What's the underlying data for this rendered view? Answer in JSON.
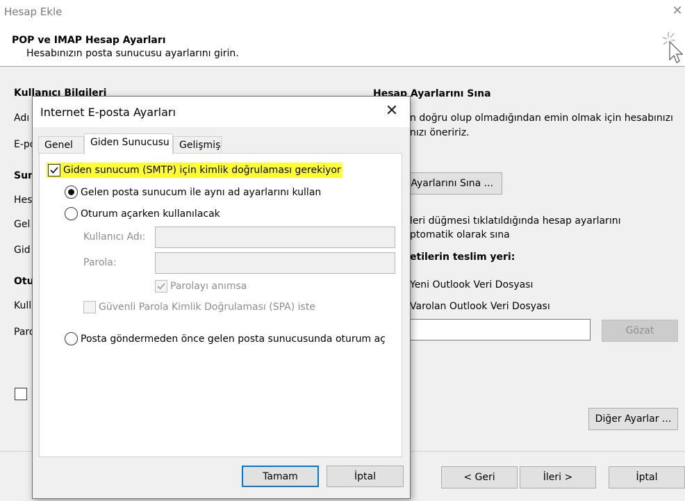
{
  "window": {
    "title": "Hesap Ekle",
    "heading": "POP ve IMAP Hesap Ayarları",
    "subheading": "Hesabınızın posta sunucusu ayarlarını girin."
  },
  "background": {
    "left_labels": [
      "Kullanıcı Bilgileri",
      "Adı",
      "E-po",
      "Sun",
      "Hes",
      "Gel",
      "Gid",
      "Otu",
      "Kull",
      "Paro"
    ],
    "test_section_title": "Hesap Ayarlarını Sına",
    "test_desc_line1": "n doğru olup olmadığından emin olmak için hesabınızı",
    "test_desc_line2": "nızı öneririz.",
    "test_button": "p Ayarlarını Sına ...",
    "auto_test_line1": "leri düğmesi tıklatıldığında hesap ayarlarını",
    "auto_test_line2": "ptomatik olarak sına",
    "delivery_title": "etilerin teslim yeri:",
    "new_pst": "Yeni Outlook Veri Dosyası",
    "existing_pst": "Varolan Outlook Veri Dosyası",
    "browse_button": "Gözat",
    "more_settings_button": "Diğer Ayarlar ...",
    "back_button": "< Geri",
    "next_button": "İleri >",
    "cancel_button": "İptal"
  },
  "dialog": {
    "title": "Internet E-posta Ayarları",
    "tabs": [
      "Genel",
      "Giden Sunucusu",
      "Gelişmiş"
    ],
    "active_tab": "Giden Sunucusu",
    "smtp_auth_label": "Giden sunucum (SMTP) için kimlik doğrulaması gerekiyor",
    "smtp_auth_checked": true,
    "radio_same_settings": "Gelen posta sunucum ile aynı ad ayarlarını kullan",
    "radio_logon_with": "Oturum açarken kullanılacak",
    "username_label": "Kullanıcı Adı:",
    "username_value": "",
    "password_label": "Parola:",
    "password_value": "",
    "remember_password": "Parolayı anımsa",
    "spa_label": "Güvenli Parola Kimlik Doğrulaması (SPA) iste",
    "radio_logon_before": "Posta göndermeden önce gelen posta sunucusunda oturum aç",
    "ok_button": "Tamam",
    "cancel_button": "İptal"
  }
}
